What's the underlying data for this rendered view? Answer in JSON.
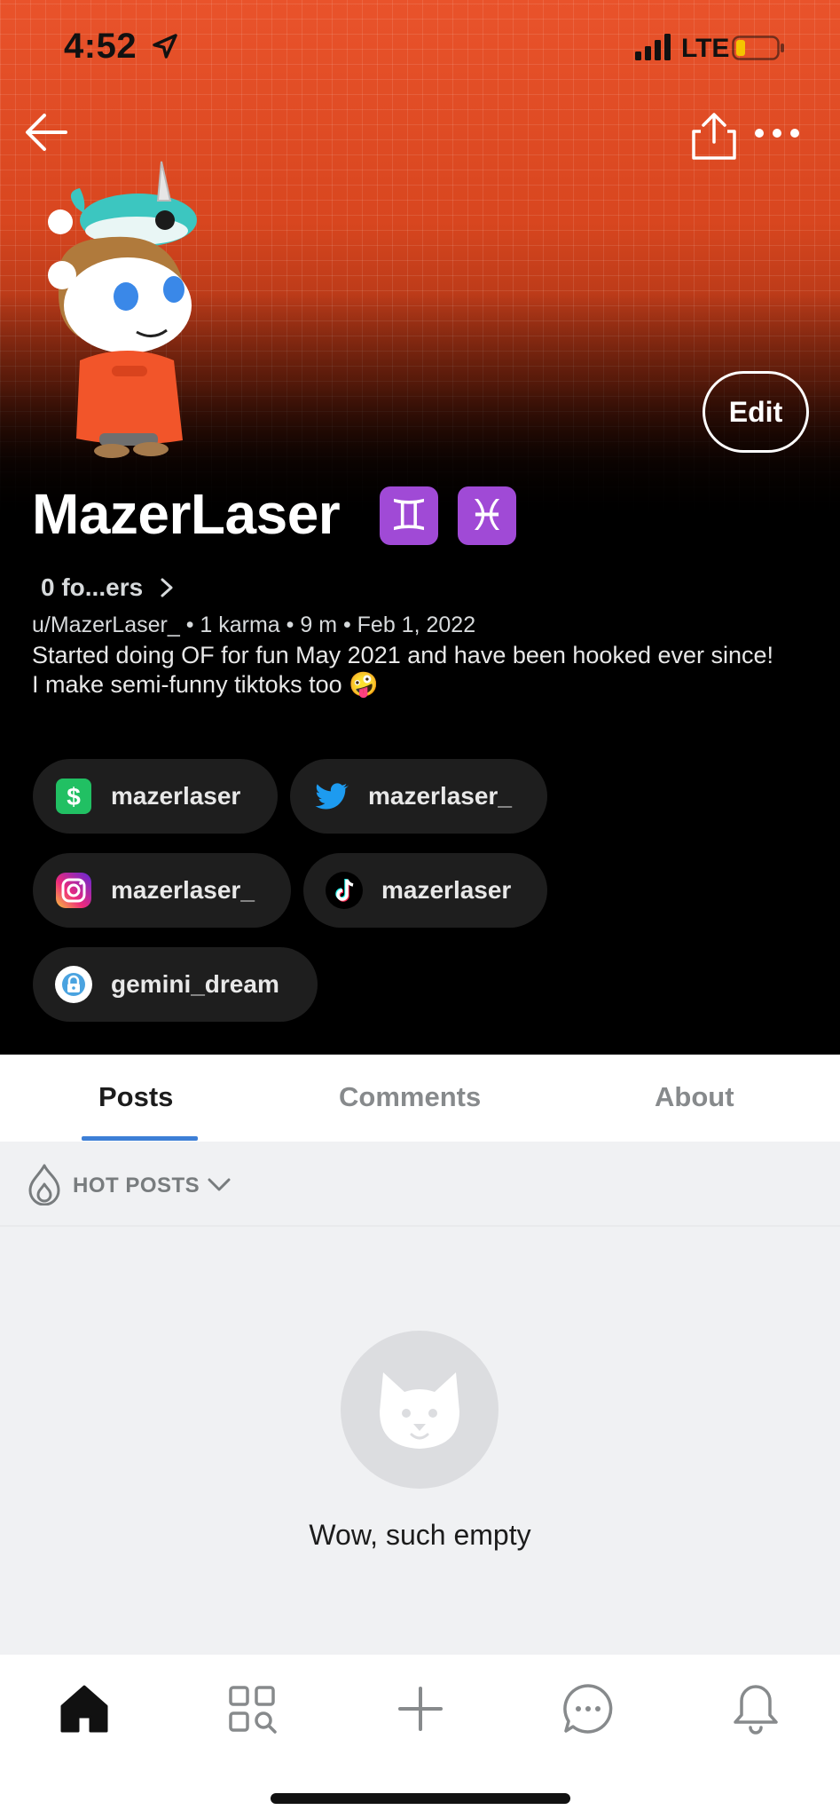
{
  "status_bar": {
    "time": "4:52",
    "network": "LTE",
    "icons": [
      "location-arrow-icon",
      "cell-signal-icon",
      "battery-low-icon"
    ]
  },
  "header": {
    "back_icon": "arrow-left-icon",
    "share_icon": "share-icon",
    "more_icon": "more-horizontal-icon",
    "edit_label": "Edit"
  },
  "profile": {
    "display_name": "MazerLaser",
    "zodiac_badges": [
      "♊",
      "♓"
    ],
    "followers_label": "0 fo...ers",
    "meta": "u/MazerLaser_ • 1 karma • 9 m • Feb 1, 2022",
    "bio": "Started doing OF for fun May 2021 and have been hooked ever since!\nI make semi-funny tiktoks too 🤪"
  },
  "social_links": [
    {
      "label": "mazerlaser",
      "icon": "cashapp-icon"
    },
    {
      "label": "mazerlaser_",
      "icon": "twitter-icon"
    },
    {
      "label": "mazerlaser_",
      "icon": "instagram-icon"
    },
    {
      "label": "mazerlaser",
      "icon": "tiktok-icon"
    },
    {
      "label": "gemini_dream",
      "icon": "onlyfans-icon"
    }
  ],
  "tabs": [
    {
      "label": "Posts",
      "active": true
    },
    {
      "label": "Comments",
      "active": false
    },
    {
      "label": "About",
      "active": false
    }
  ],
  "feed": {
    "sort_label": "HOT POSTS",
    "empty_text": "Wow, such empty"
  },
  "bottom_nav": [
    "home-icon",
    "discover-icon",
    "create-icon",
    "chat-icon",
    "notifications-icon"
  ],
  "colors": {
    "banner": "#e9532b",
    "tab_underline": "#3d7fd6",
    "zodiac_badge": "#a04ad6",
    "chip_bg": "#1e1e1e"
  }
}
